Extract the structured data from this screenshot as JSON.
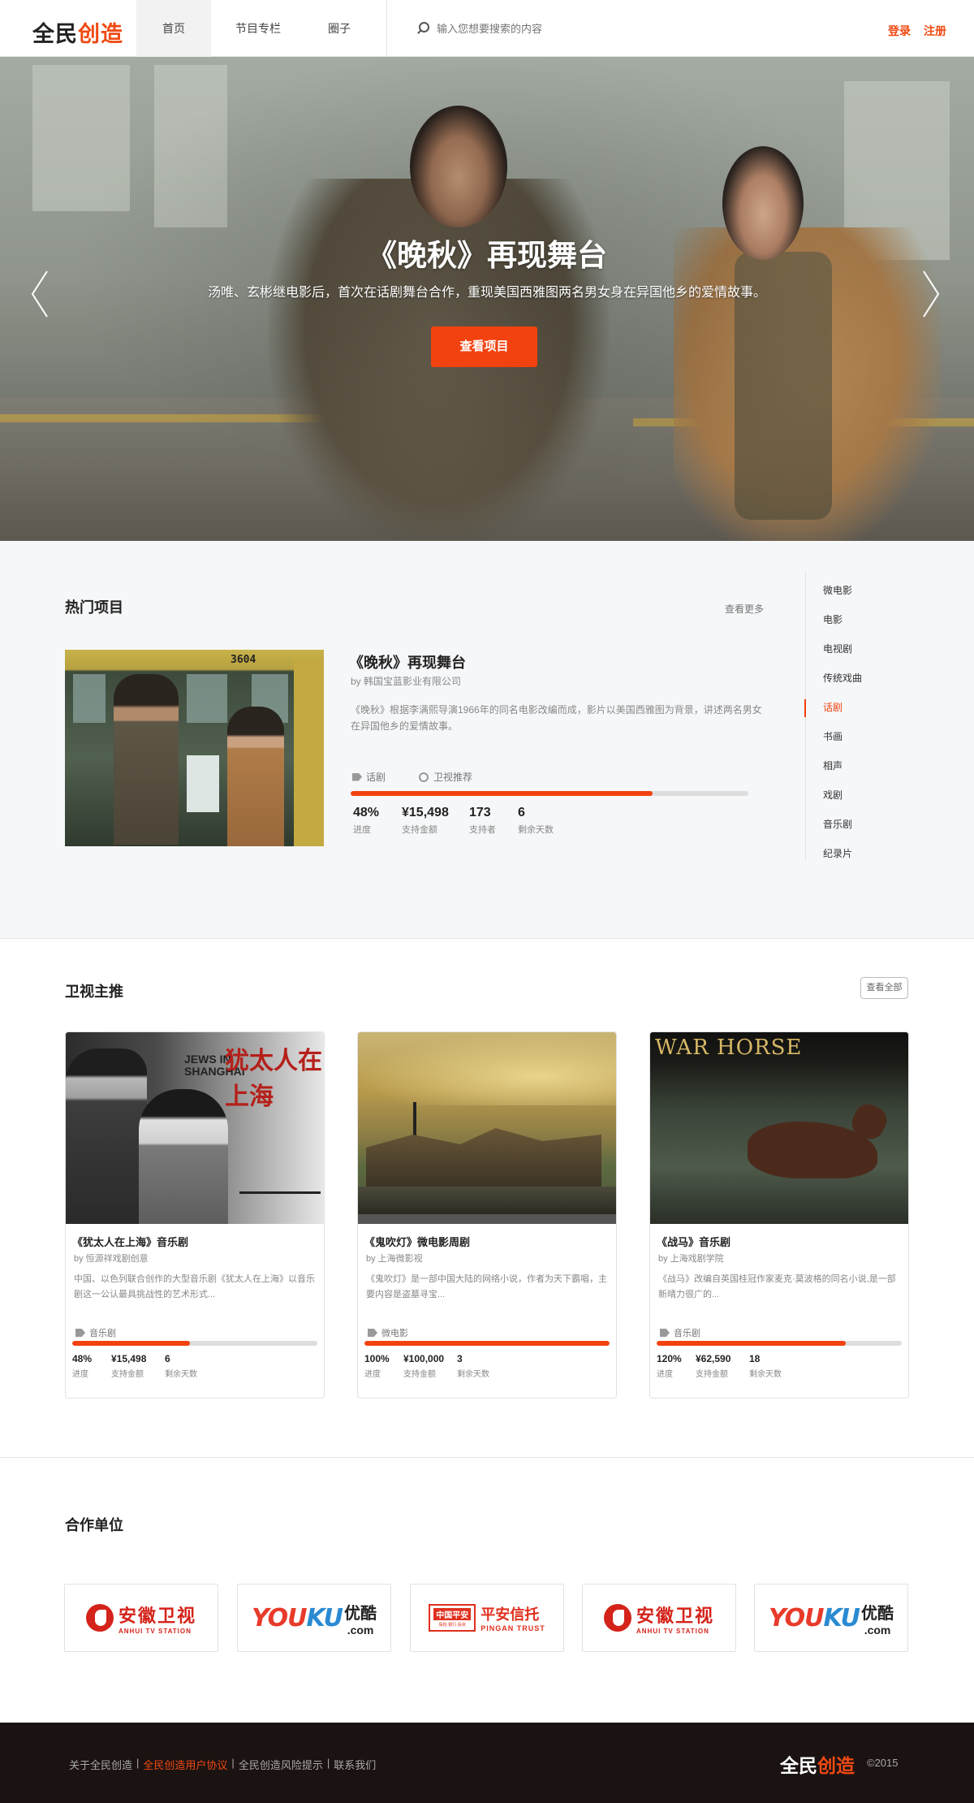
{
  "header": {
    "logo_part1": "全民",
    "logo_part2": "创造",
    "nav": [
      "首页",
      "节目专栏",
      "圈子"
    ],
    "search_placeholder": "输入您想要搜索的内容",
    "login": "登录",
    "register": "注册"
  },
  "hero": {
    "title": "《晚秋》再现舞台",
    "subtitle": "汤唯、玄彬继电影后，首次在话剧舞台合作，重现美国西雅图两名男女身在异国他乡的爱情故事。",
    "button": "查看项目"
  },
  "hot": {
    "title": "热门项目",
    "more": "查看更多",
    "project": {
      "name": "《晚秋》再现舞台",
      "by": "by 韩国宝蓝影业有限公司",
      "desc": "《晚秋》根据李满熙导演1966年的同名电影改编而成，影片以美国西雅图为背景，讲述两名男女在异国他乡的爱情故事。",
      "tag": "话剧",
      "recommend": "卫视推荐",
      "image_text": "3604",
      "progress": 0.76,
      "stats": [
        {
          "value": "48%",
          "label": "进度"
        },
        {
          "value": "¥15,498",
          "label": "支持金额"
        },
        {
          "value": "173",
          "label": "支持者"
        },
        {
          "value": "6",
          "label": "剩余天数"
        }
      ]
    },
    "categories": [
      "微电影",
      "电影",
      "电视剧",
      "传统戏曲",
      "话剧",
      "书画",
      "相声",
      "戏剧",
      "音乐剧",
      "纪录片"
    ],
    "active_category": "话剧"
  },
  "tv": {
    "title": "卫视主推",
    "all": "查看全部",
    "cards": [
      {
        "title": "《犹太人在上海》音乐剧",
        "by": "by 恒源祥戏剧创意",
        "desc": "中国、以色列联合创作的大型音乐剧《犹太人在上海》以音乐剧这一公认最具挑战性的艺术形式...",
        "tag": "音乐剧",
        "progress": 0.48,
        "image_title": "犹太人在上海",
        "image_en": "JEWS IN SHANGHAI",
        "stats": [
          {
            "value": "48%",
            "label": "进度"
          },
          {
            "value": "¥15,498",
            "label": "支持金额"
          },
          {
            "value": "6",
            "label": "剩余天数"
          }
        ]
      },
      {
        "title": "《鬼吹灯》微电影周剧",
        "by": "by 上海微影视",
        "desc": "《鬼吹灯》是一部中国大陆的网络小说，作者为天下霸唱，主要内容是盗墓寻宝...",
        "tag": "微电影",
        "progress": 1.0,
        "stats": [
          {
            "value": "100%",
            "label": "进度"
          },
          {
            "value": "¥100,000",
            "label": "支持金额"
          },
          {
            "value": "3",
            "label": "剩余天数"
          }
        ]
      },
      {
        "title": "《战马》音乐剧",
        "by": "by 上海戏剧学院",
        "desc": "《战马》改编自英国桂冠作家麦克·莫波格的同名小说,是一部新晴力很广的...",
        "tag": "音乐剧",
        "progress": 0.77,
        "image_title": "WAR HORSE",
        "stats": [
          {
            "value": "120%",
            "label": "进度"
          },
          {
            "value": "¥62,590",
            "label": "支持金额"
          },
          {
            "value": "18",
            "label": "剩余天数"
          }
        ]
      }
    ]
  },
  "partners": {
    "title": "合作单位",
    "logos": [
      {
        "cn": "安徽卫视",
        "en": "ANHUI TV STATION"
      },
      {
        "en_a": "YOU",
        "en_b": "KU",
        "cn": "优酷",
        "com": ".com"
      },
      {
        "box": "中国平安",
        "box_sub": "保险·银行·投资",
        "cn": "平安信托",
        "en": "PINGAN TRUST"
      },
      {
        "cn": "安徽卫视",
        "en": "ANHUI TV STATION"
      },
      {
        "en_a": "YOU",
        "en_b": "KU",
        "cn": "优酷",
        "com": ".com"
      }
    ]
  },
  "footer": {
    "links": [
      "关于全民创造",
      "全民创造用户协议",
      "全民创造风险提示",
      "联系我们"
    ],
    "sep": "|",
    "logo_part1": "全民",
    "logo_part2": "创造",
    "copyright": "©2015"
  },
  "colors": {
    "accent": "#f2420f",
    "footer_bg": "#1b1212"
  }
}
